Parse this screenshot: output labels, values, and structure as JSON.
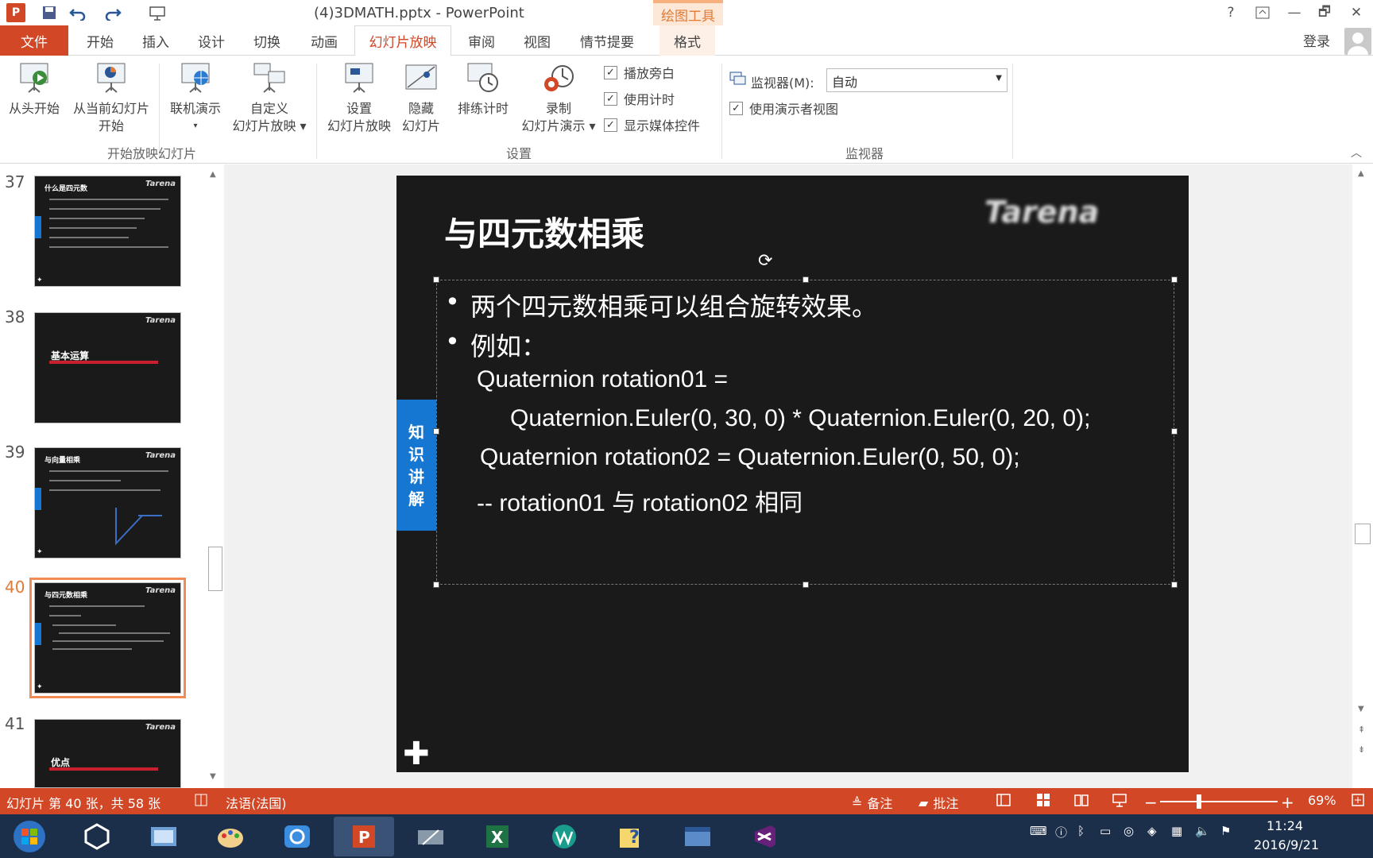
{
  "window": {
    "title": "(4)3DMATH.pptx - PowerPoint",
    "context_tab": "绘图工具",
    "help": "?",
    "minimize": "—",
    "restore": "🗗",
    "close": "✕"
  },
  "tabs": [
    {
      "label": "文件"
    },
    {
      "label": "开始"
    },
    {
      "label": "插入"
    },
    {
      "label": "设计"
    },
    {
      "label": "切换"
    },
    {
      "label": "动画"
    },
    {
      "label": "幻灯片放映"
    },
    {
      "label": "审阅"
    },
    {
      "label": "视图"
    },
    {
      "label": "情节提要"
    },
    {
      "label": "格式"
    }
  ],
  "login": "登录",
  "ribbon": {
    "start_group": {
      "label": "开始放映幻灯片",
      "from_start": "从头开始",
      "from_current_1": "从当前幻灯片",
      "from_current_2": "开始",
      "online_1": "联机演示",
      "custom_1": "自定义",
      "custom_2": "幻灯片放映 ▾"
    },
    "setup_group": {
      "label": "设置",
      "setup_1": "设置",
      "setup_2": "幻灯片放映",
      "hide_1": "隐藏",
      "hide_2": "幻灯片",
      "rehearse": "排练计时",
      "record_1": "录制",
      "record_2": "幻灯片演示 ▾",
      "narration": "播放旁白",
      "timings": "使用计时",
      "media": "显示媒体控件"
    },
    "monitor_group": {
      "label": "监视器",
      "monitor_label": "监视器(M):",
      "monitor_value": "自动",
      "presenter_view": "使用演示者视图"
    }
  },
  "thumbnails": [
    {
      "num": "37",
      "title": "什么是四元数"
    },
    {
      "num": "38",
      "title": "基本运算"
    },
    {
      "num": "39",
      "title": "与向量相乘"
    },
    {
      "num": "40",
      "title": "与四元数相乘"
    },
    {
      "num": "41",
      "title": "优点"
    }
  ],
  "slide": {
    "title": "与四元数相乘",
    "side_tab": [
      "知",
      "识",
      "讲",
      "解"
    ],
    "bullet_char": "•",
    "bullets": [
      "两个四元数相乘可以组合旋转效果。",
      "例如："
    ],
    "code": [
      "Quaternion rotation01 =",
      "Quaternion.Euler(0, 30, 0) * Quaternion.Euler(0, 20, 0);",
      "Quaternion rotation02 = Quaternion.Euler(0, 50, 0);",
      "-- rotation01 与 rotation02 相同"
    ]
  },
  "status": {
    "slide_info": "幻灯片 第 40 张，共 58 张",
    "language": "法语(法国)",
    "notes": "备注",
    "comments": "批注",
    "zoom": "69%"
  },
  "taskbar": {
    "time": "11:24",
    "date": "2016/9/21"
  },
  "colors": {
    "accent": "#d24726",
    "slide_bg": "#1b1a1a",
    "side_tab": "#1677d2"
  }
}
